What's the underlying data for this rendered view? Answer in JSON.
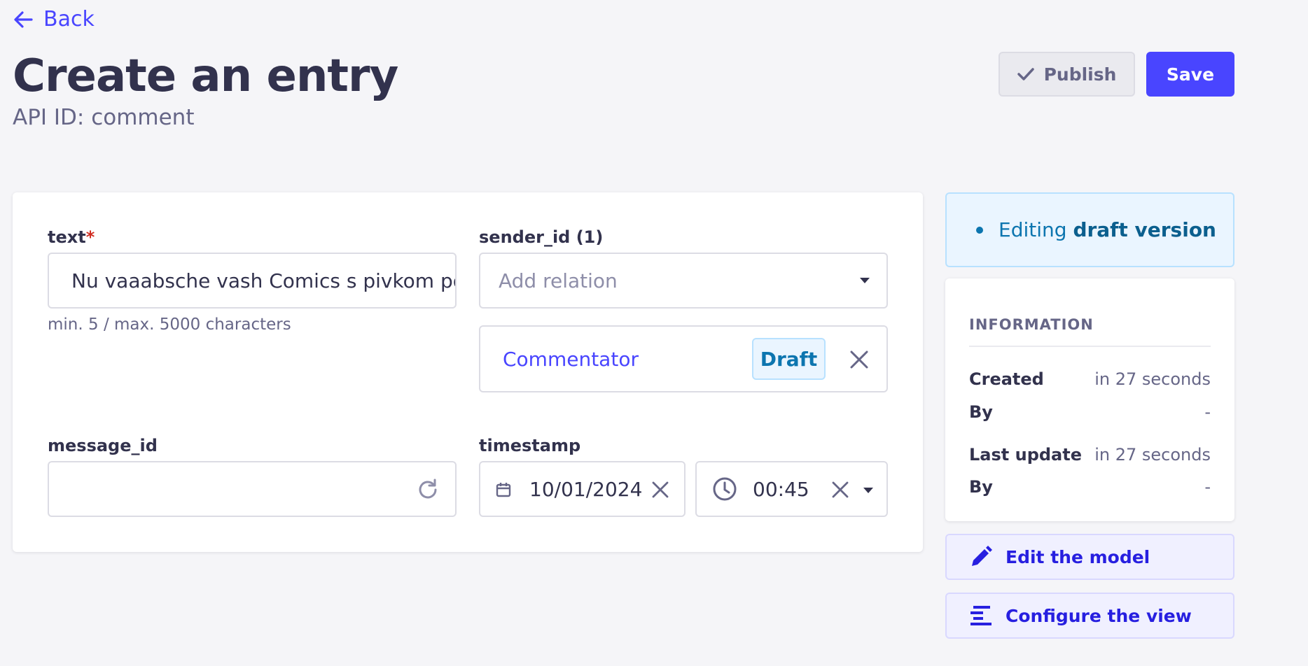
{
  "nav": {
    "back_label": "Back"
  },
  "header": {
    "title": "Create an entry",
    "subtitle": "API ID: comment",
    "publish_label": "Publish",
    "save_label": "Save"
  },
  "fields": {
    "text": {
      "label": "text",
      "required_mark": "*",
      "value": "Nu vaaabsche vash Comics s pivkom po",
      "hint": "min. 5 / max. 5000 characters"
    },
    "sender_id": {
      "label": "sender_id (1)",
      "placeholder": "Add relation",
      "relation": {
        "name": "Commentator",
        "status": "Draft"
      }
    },
    "message_id": {
      "label": "message_id",
      "value": ""
    },
    "timestamp": {
      "label": "timestamp",
      "date": "10/01/2024",
      "time": "00:45"
    }
  },
  "sidebar": {
    "draft_notice": {
      "prefix": "Editing",
      "emphasis": "draft version"
    },
    "information": {
      "title": "INFORMATION",
      "rows": [
        {
          "key": "Created",
          "value": "in 27 seconds"
        },
        {
          "key": "By",
          "value": "-"
        },
        {
          "key": "Last update",
          "value": "in 27 seconds"
        },
        {
          "key": "By",
          "value": "-"
        }
      ]
    },
    "edit_model_label": "Edit the model",
    "configure_view_label": "Configure the view"
  },
  "icons": {
    "back": "arrow-left-icon",
    "publish": "check-icon",
    "regenerate": "refresh-icon",
    "calendar": "calendar-icon",
    "clock": "clock-icon",
    "clear": "close-icon",
    "dropdown": "caret-down-icon",
    "edit": "pencil-icon",
    "configure": "list-settings-icon"
  },
  "colors": {
    "primary": "#4945ff",
    "text": "#32324d",
    "muted": "#666687",
    "info_bg": "#eaf5ff",
    "info_text": "#0c75af",
    "danger": "#d02b20"
  }
}
